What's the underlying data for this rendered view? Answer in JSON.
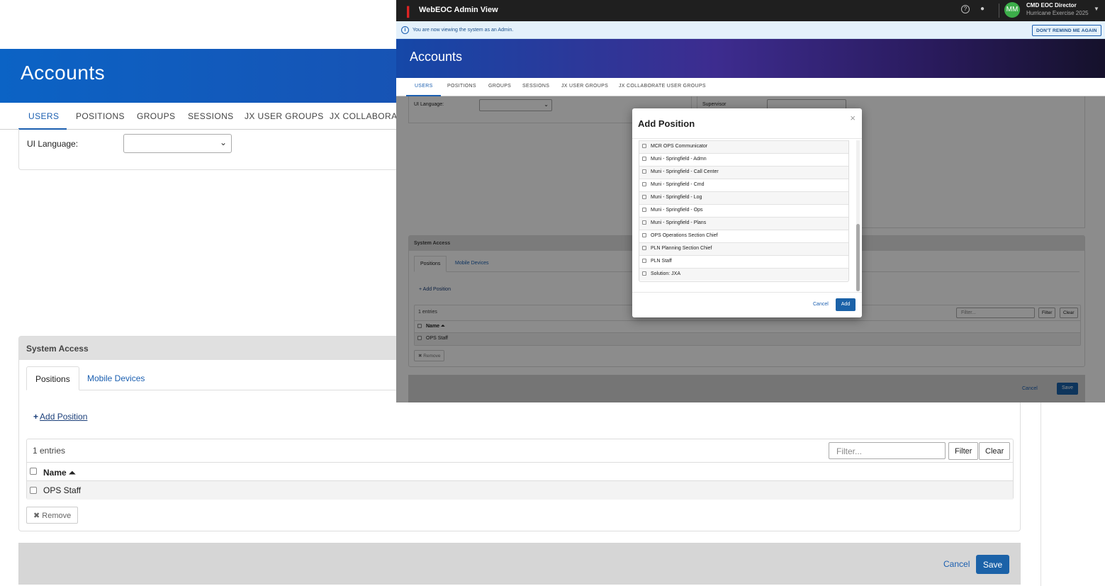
{
  "background": {
    "page_title": "Accounts",
    "tabs": [
      "USERS",
      "POSITIONS",
      "GROUPS",
      "SESSIONS",
      "JX USER GROUPS",
      "JX COLLABORATE"
    ],
    "ui_language_label": "UI Language:",
    "system_access": {
      "heading": "System Access",
      "subtabs": [
        "Positions",
        "Mobile Devices"
      ],
      "add_position": "Add Position",
      "entries": "1 entries",
      "filter_placeholder": "Filter...",
      "filter_button": "Filter",
      "clear_button": "Clear",
      "name_header": "Name",
      "rows": [
        "OPS Staff"
      ],
      "remove_button": "Remove"
    },
    "footer": {
      "cancel": "Cancel",
      "save": "Save"
    }
  },
  "foreground": {
    "app_title": "WebEOC Admin View",
    "user": {
      "initials": "MM",
      "name": "CMD EOC Director",
      "incident": "Hurricane Exercise 2025"
    },
    "info_message": "You are now viewing the system as an Admin.",
    "dont_remind": "DON'T REMIND ME AGAIN",
    "page_title": "Accounts",
    "tabs": [
      "USERS",
      "POSITIONS",
      "GROUPS",
      "SESSIONS",
      "JX USER GROUPS",
      "JX COLLABORATE USER GROUPS"
    ],
    "ui_language_label": "UI Language:",
    "supervisor_label": "Supervisor",
    "system_access": {
      "heading": "System Access",
      "subtabs": [
        "Positions",
        "Mobile Devices"
      ],
      "add_position": "Add Position",
      "entries": "1 entries",
      "filter_placeholder": "Filter...",
      "filter_button": "Filter",
      "clear_button": "Clear",
      "name_header": "Name",
      "rows": [
        "OPS Staff"
      ],
      "remove_button": "Remove"
    },
    "footer": {
      "cancel": "Cancel",
      "save": "Save"
    },
    "modal": {
      "title": "Add Position",
      "items": [
        "MCR OPS Communicator",
        "Muni - Springfield - Admn",
        "Muni - Springfield - Call Center",
        "Muni - Springfield - Cmd",
        "Muni - Springfield - Log",
        "Muni - Springfield - Ops",
        "Muni - Springfield - Plans",
        "OPS Operations Section Chief",
        "PLN Planning Section Chief",
        "PLN Staff",
        "Solution: JXA"
      ],
      "cancel": "Cancel",
      "add": "Add"
    }
  }
}
